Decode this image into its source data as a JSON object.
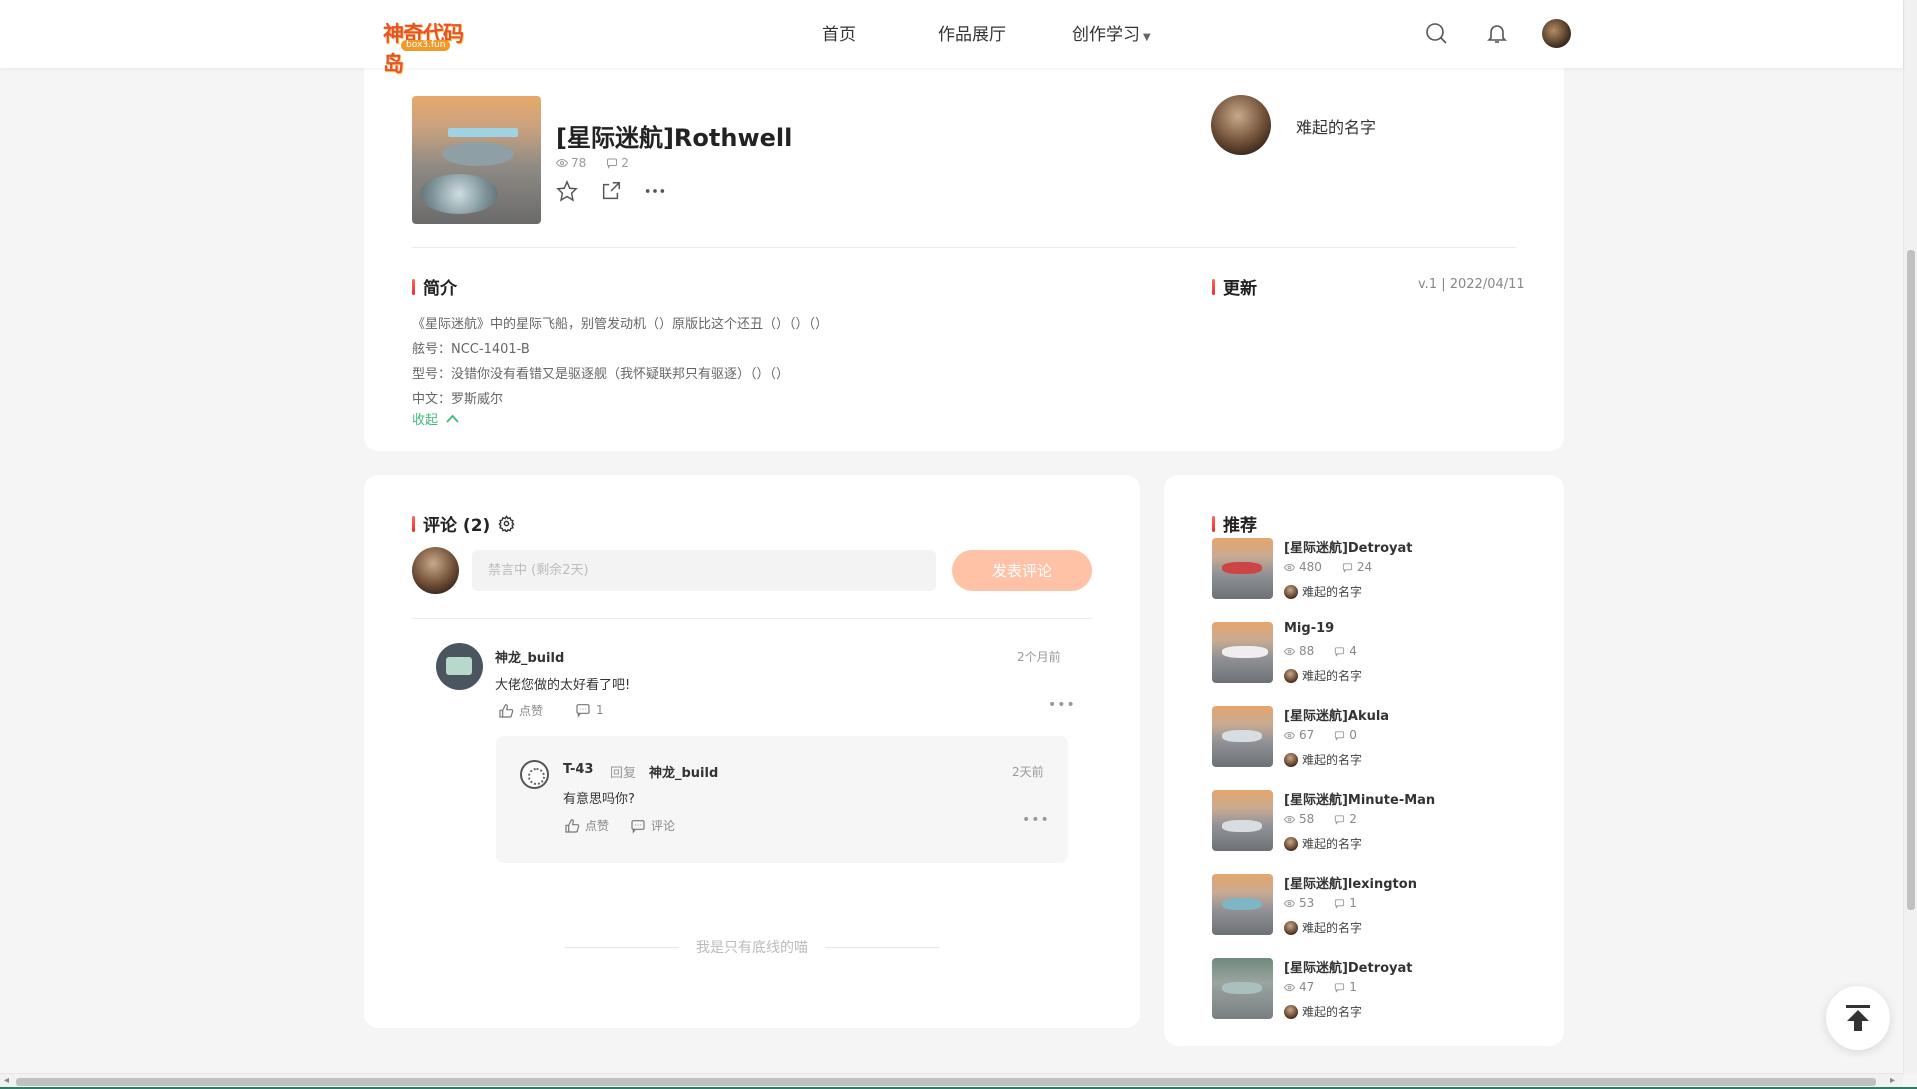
{
  "header": {
    "logo_text": "神奇代码岛",
    "logo_sub": "box3.fun",
    "nav": {
      "home": "首页",
      "gallery": "作品展厅",
      "learn": "创作学习"
    },
    "icons": [
      "search-icon",
      "bell-icon",
      "user-avatar"
    ]
  },
  "work": {
    "title": "[星际迷航]Rothwell",
    "views": "78",
    "comments": "2",
    "author": "难起的名字",
    "actions": [
      "star-icon",
      "share-icon",
      "more-icon"
    ]
  },
  "intro": {
    "title": "简介",
    "lines": [
      "《星际迷航》中的星际飞船，别管发动机（）原版比这个还丑（）（）（）",
      "舷号：NCC-1401-B",
      "型号：没错你没有看错又是驱逐舰（我怀疑联邦只有驱逐）（）（）",
      "中文：罗斯威尔"
    ],
    "collapse": "收起"
  },
  "update": {
    "title": "更新",
    "meta": "v.1 | 2022/04/11"
  },
  "comments": {
    "title": "评论 (2)",
    "placeholder": "禁言中 (剩余2天)",
    "post_button": "发表评论",
    "items": [
      {
        "user": "神龙_build",
        "time": "2个月前",
        "text": "大佬您做的太好看了吧!",
        "like": "点赞",
        "reply_count": "1",
        "replies": [
          {
            "user": "T-43",
            "reply_word": "回复",
            "reply_to": "神龙_build",
            "time": "2天前",
            "text": "有意思吗你?",
            "like": "点赞",
            "comment": "评论"
          }
        ]
      }
    ],
    "bottom_note": "我是只有底线的喵"
  },
  "recommend": {
    "title": "推荐",
    "items": [
      {
        "name": "[星际迷航]Detroyat",
        "views": "480",
        "comments": "24",
        "author": "难起的名字"
      },
      {
        "name": "Mig-19",
        "views": "88",
        "comments": "4",
        "author": "难起的名字"
      },
      {
        "name": "[星际迷航]Akula",
        "views": "67",
        "comments": "0",
        "author": "难起的名字"
      },
      {
        "name": "[星际迷航]Minute-Man",
        "views": "58",
        "comments": "2",
        "author": "难起的名字"
      },
      {
        "name": "[星际迷航]lexington",
        "views": "53",
        "comments": "1",
        "author": "难起的名字"
      },
      {
        "name": "[星际迷航]Detroyat",
        "views": "47",
        "comments": "1",
        "author": "难起的名字"
      }
    ]
  },
  "colors": {
    "accent_red": "#ea2d2d",
    "green_link": "#3fbb7a",
    "post_button": "#ffc2a6"
  }
}
